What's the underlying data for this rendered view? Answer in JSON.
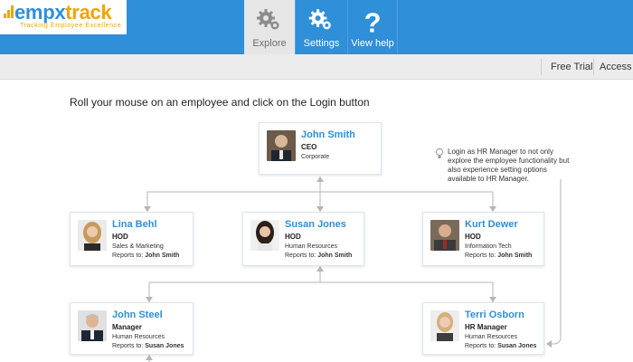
{
  "logo": {
    "brand_part1": "empx",
    "brand_part2": "track",
    "tagline": "Tracking Employee Excellence"
  },
  "nav": {
    "explore": {
      "label": "Explore",
      "icon": "gears-icon"
    },
    "settings": {
      "label": "Settings",
      "icon": "gears-icon"
    },
    "help": {
      "label": "View help",
      "icon": "question-icon"
    }
  },
  "subbar": {
    "free_trial": "Free Trial",
    "access": "Access e"
  },
  "instruction": "Roll your mouse on an employee and click on the Login button",
  "hint": "Login as HR Manager to not only explore the employee functionality but also experience setting options available to HR Manager.",
  "org": {
    "ceo": {
      "name": "John Smith",
      "role": "CEO",
      "dept": "Corporate"
    },
    "lina": {
      "name": "Lina Behl",
      "role": "HOD",
      "dept": "Sales & Marketing",
      "reports_label": "Reports to:",
      "reports_to": "John Smith"
    },
    "susan": {
      "name": "Susan Jones",
      "role": "HOD",
      "dept": "Human Resources",
      "reports_label": "Reports to:",
      "reports_to": "John Smith"
    },
    "kurt": {
      "name": "Kurt Dewer",
      "role": "HOD",
      "dept": "Information Tech",
      "reports_label": "Reports to:",
      "reports_to": "John Smith"
    },
    "steel": {
      "name": "John Steel",
      "role": "Manager",
      "dept": "Human Resources",
      "reports_label": "Reports to:",
      "reports_to": "Susan Jones"
    },
    "terri": {
      "name": "Terri Osborn",
      "role": "HR Manager",
      "dept": "Human Resources",
      "reports_label": "Reports to:",
      "reports_to": "Susan Jones"
    }
  },
  "colors": {
    "primary": "#2f8fd8",
    "accent": "#f0a400",
    "nav_active_bg": "#e6e6e6",
    "subbar_bg": "#ececec"
  }
}
